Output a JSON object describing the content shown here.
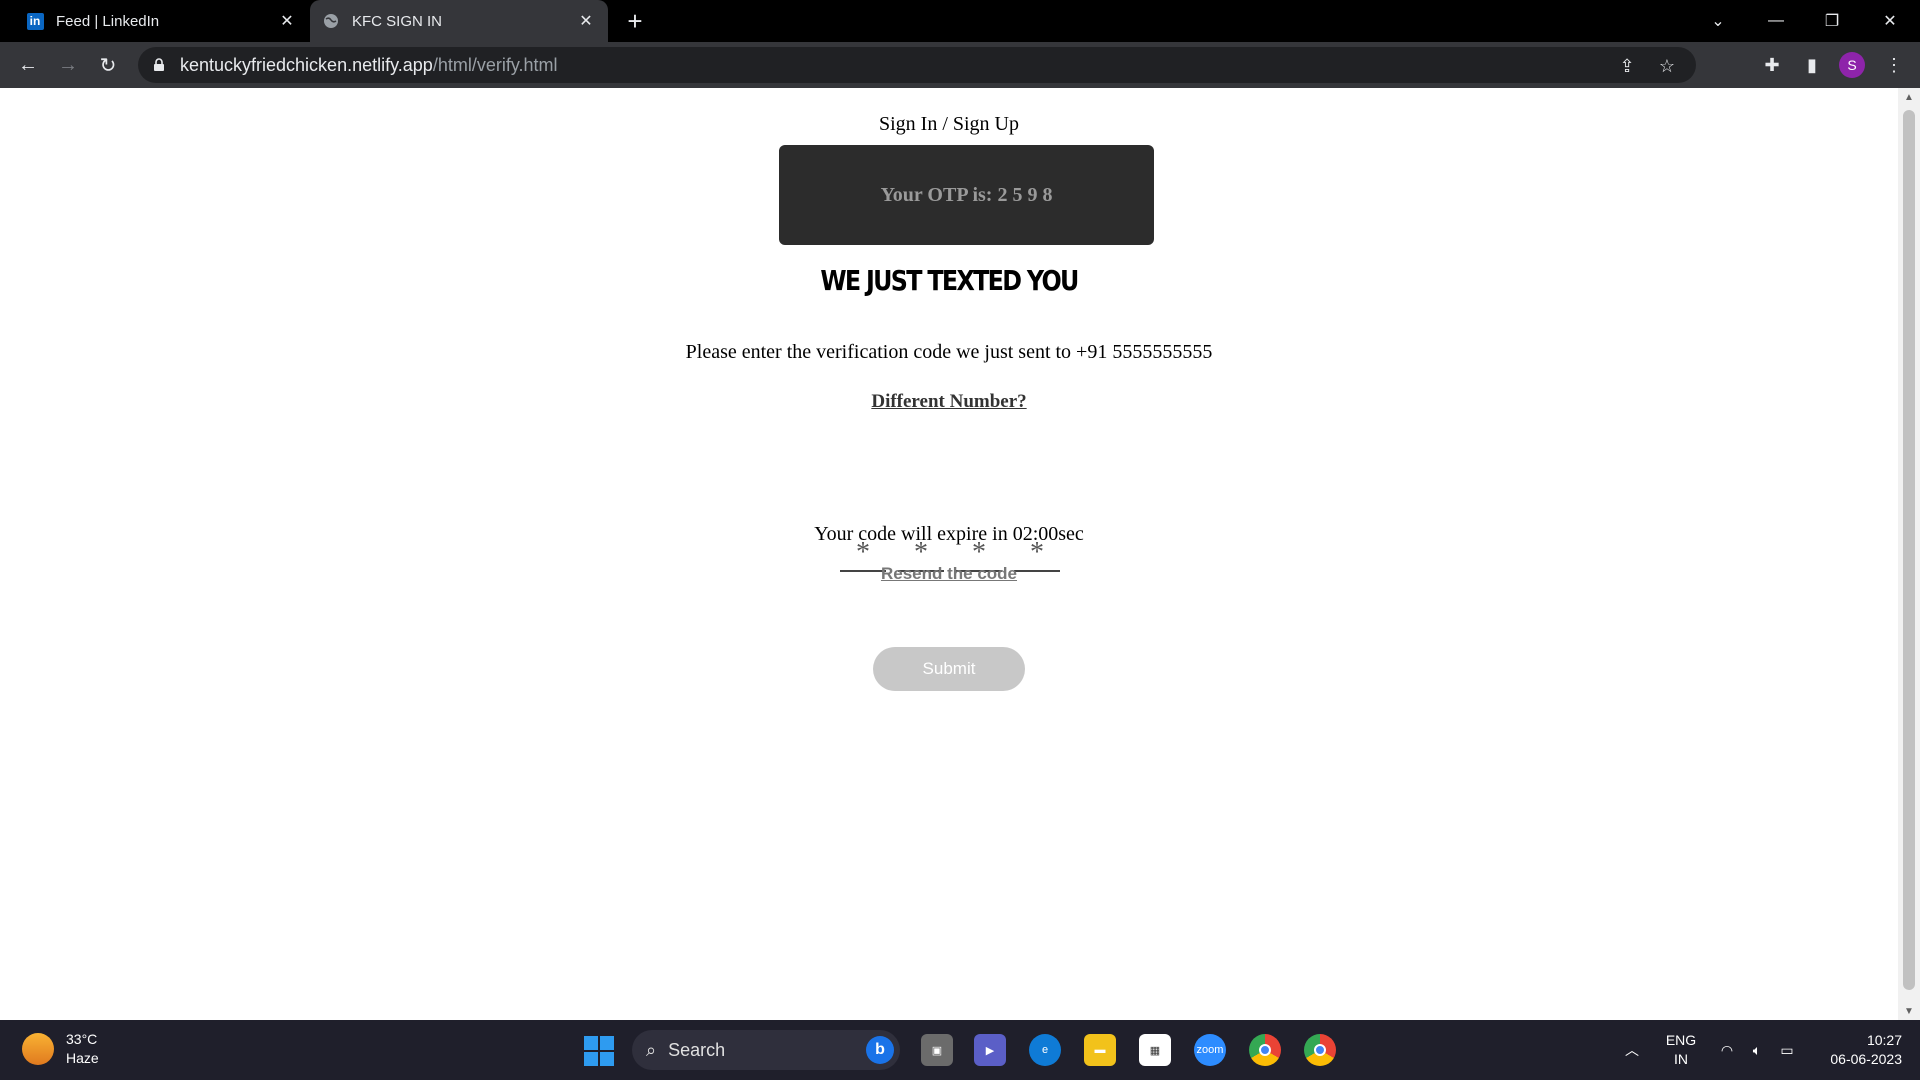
{
  "browser": {
    "tabs": [
      {
        "title": "Feed | LinkedIn",
        "icon": "linkedin-icon"
      },
      {
        "title": "KFC SIGN IN",
        "icon": "globe-icon"
      }
    ],
    "url_host": "kentuckyfriedchicken.netlify.app",
    "url_path": "/html/verify.html",
    "profile_initial": "S"
  },
  "page": {
    "title": "Sign In / Sign Up",
    "otp_message": "Your OTP is: 2 5 9 8",
    "headline": "WE JUST TEXTED YOU",
    "instruction": "Please enter the verification code we just sent to +91 5555555555",
    "different_number": "Different Number?",
    "otp_placeholder": "*",
    "expire_text": "Your code will expire in 02:00sec",
    "resend": "Resend the code",
    "submit": "Submit"
  },
  "taskbar": {
    "weather_temp": "33°C",
    "weather_desc": "Haze",
    "search_label": "Search",
    "lang_line1": "ENG",
    "lang_line2": "IN",
    "time": "10:27",
    "date": "06-06-2023"
  }
}
